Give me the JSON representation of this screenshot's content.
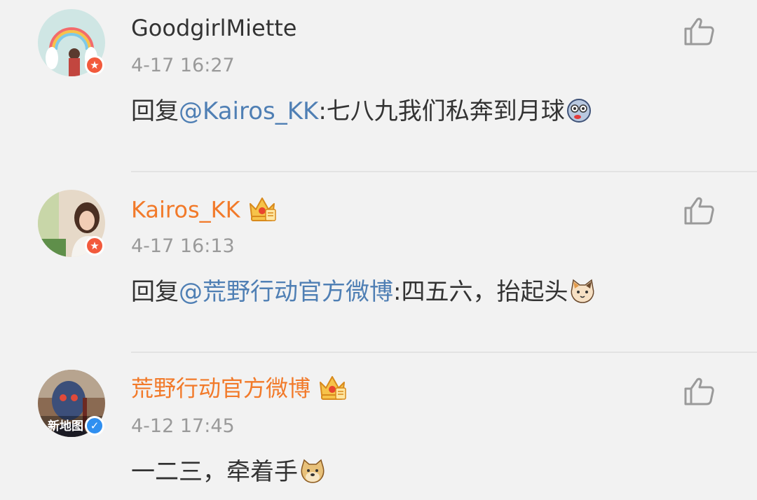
{
  "comments": [
    {
      "username": "GoodgirlMiette",
      "time": "4-17 16:27",
      "reply_prefix": "回复",
      "mention": "@Kairos_KK",
      "text": ":七八九我们私奔到月球",
      "emoji": "dizzy-face-emoji",
      "badge": "red-star",
      "vip": false
    },
    {
      "username": "Kairos_KK",
      "time": "4-17 16:13",
      "reply_prefix": "回复",
      "mention": "@荒野行动官方微博",
      "text": ":四五六，抬起头",
      "emoji": "cat-face-emoji",
      "badge": "red-star",
      "vip": true
    },
    {
      "username": "荒野行动官方微博",
      "time": "4-12 17:45",
      "text": "一二三，牵着手",
      "emoji": "doge-emoji",
      "badge": "blue-verified",
      "vip": true,
      "avatar_text": "新地图"
    }
  ],
  "colors": {
    "background": "#f2f2f2",
    "username_plain": "#333333",
    "username_vip": "#f27a2a",
    "mention": "#4f7fb4",
    "time": "#9a9a9a",
    "badge_red": "#f25a3c",
    "badge_blue": "#2f8ff0"
  }
}
